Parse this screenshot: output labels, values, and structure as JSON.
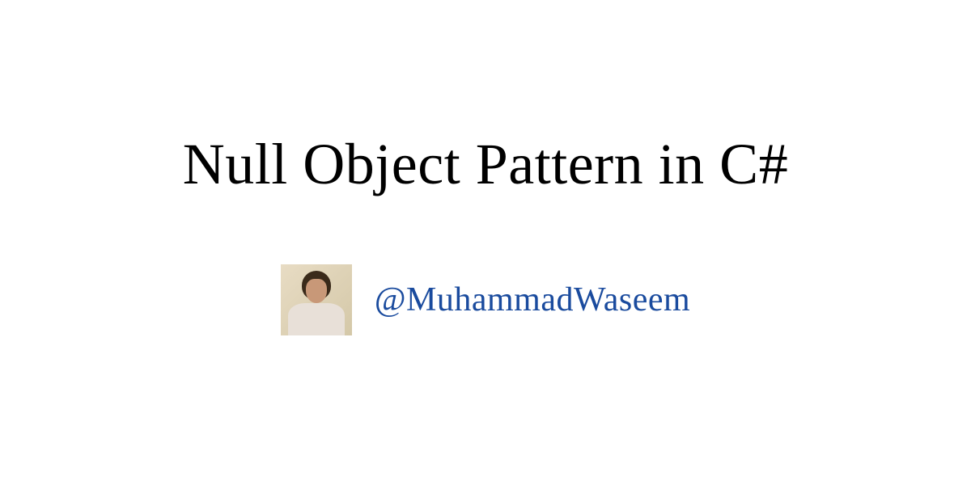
{
  "title": "Null Object Pattern in C#",
  "author": {
    "handle": "@MuhammadWaseem"
  }
}
